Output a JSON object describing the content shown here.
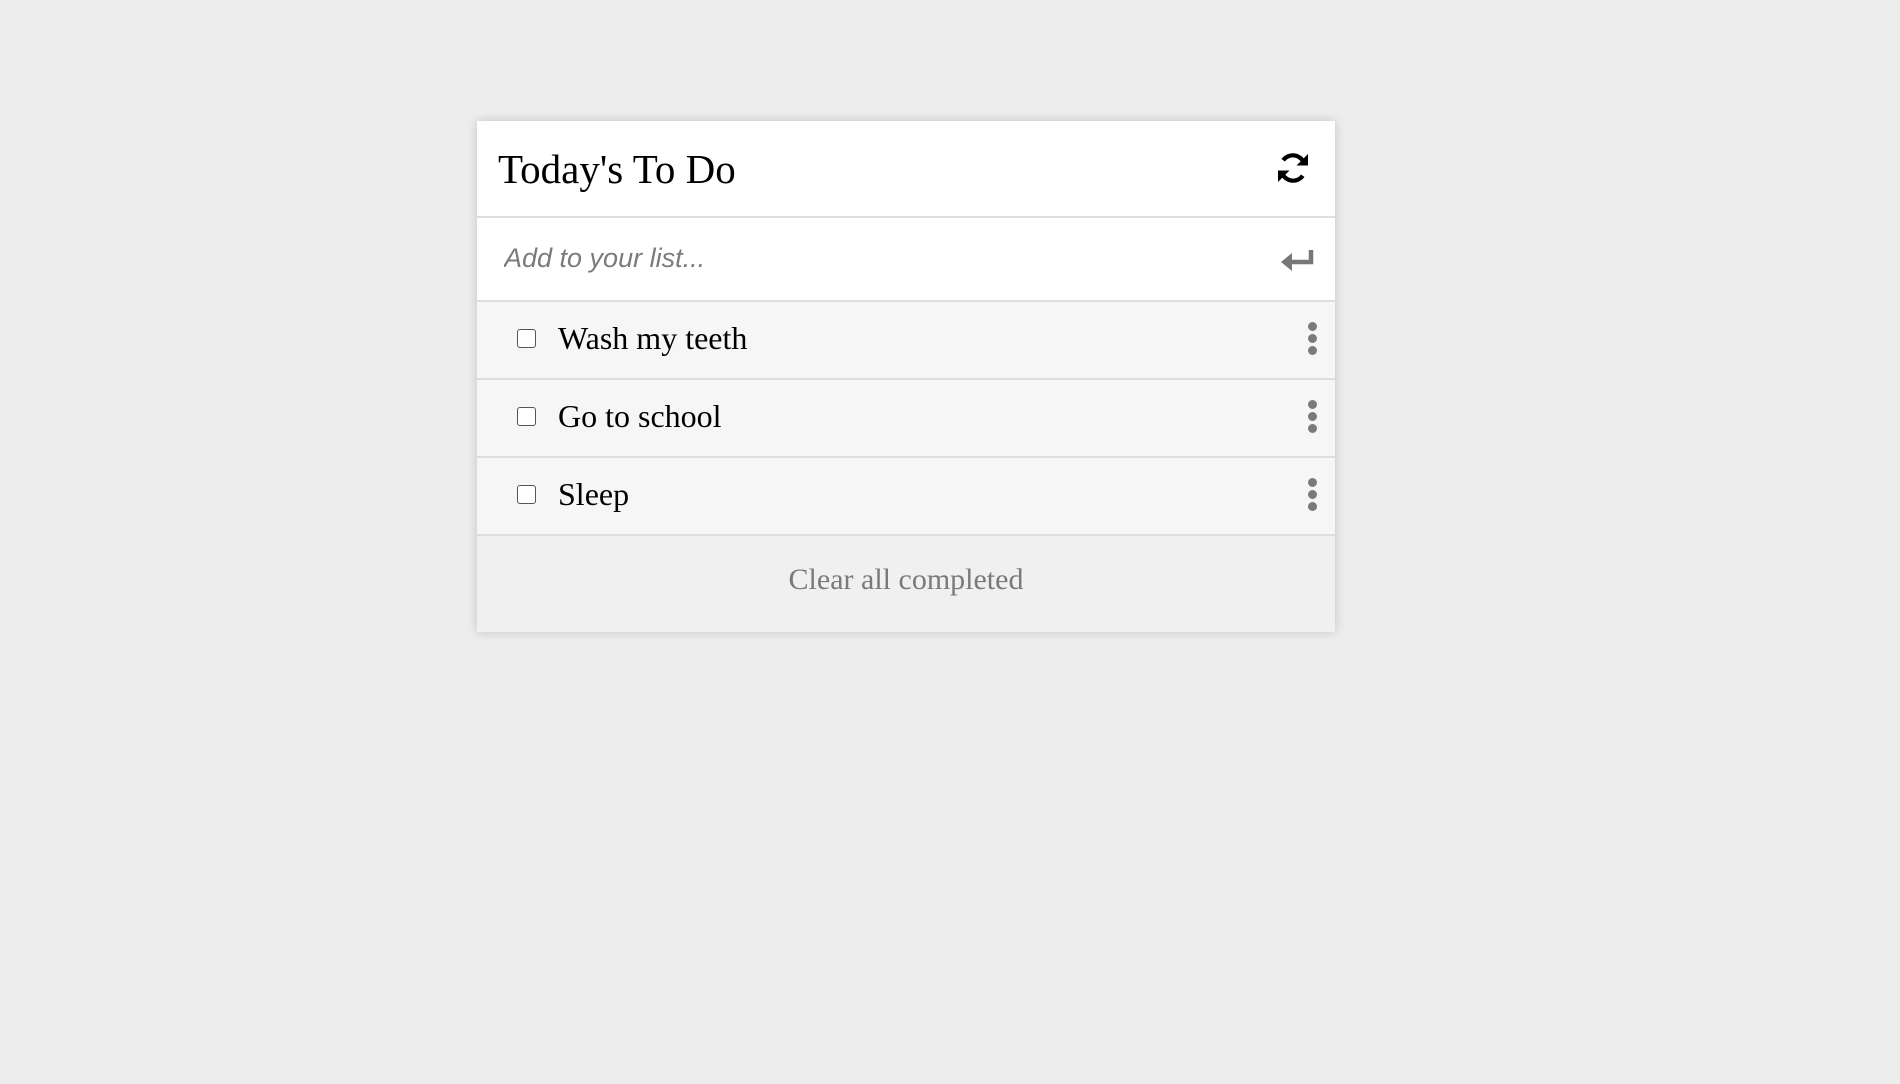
{
  "app": {
    "title": "Today's To Do"
  },
  "header": {
    "refresh_icon": "refresh-icon"
  },
  "add_item": {
    "placeholder": "Add to your list...",
    "value": "",
    "submit_icon": "enter-icon"
  },
  "todos": [
    {
      "text": "Wash my teeth",
      "completed": false
    },
    {
      "text": "Go to school",
      "completed": false
    },
    {
      "text": "Sleep",
      "completed": false
    }
  ],
  "footer": {
    "clear_label": "Clear all completed"
  },
  "colors": {
    "background": "#ededed",
    "card": "#ffffff",
    "item_background": "#f6f6f6",
    "footer_background": "#f0f0f0",
    "muted_text": "#7a7a7a"
  }
}
